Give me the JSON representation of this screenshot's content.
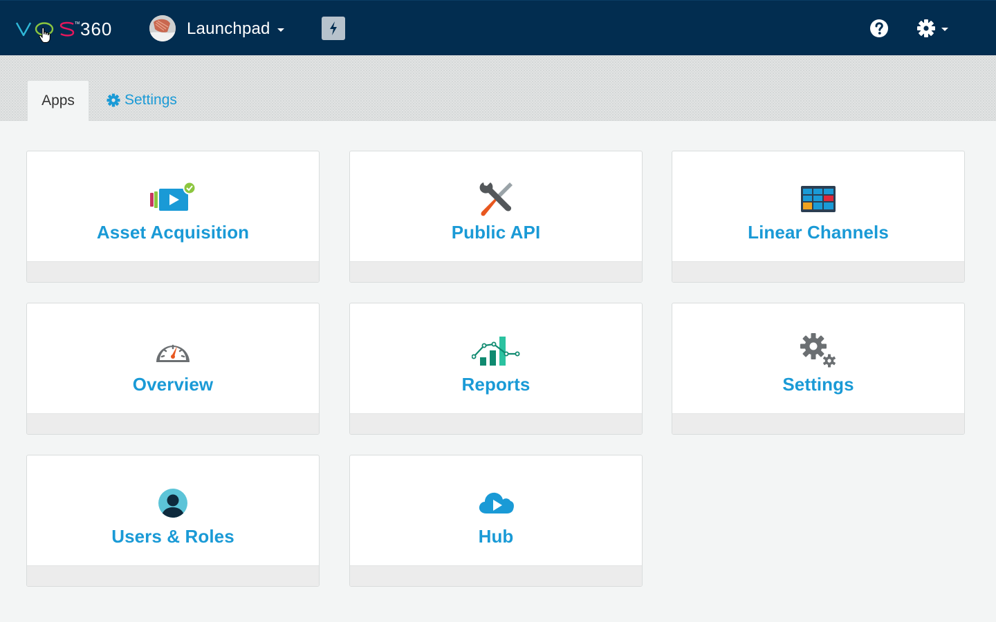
{
  "header": {
    "logo_text": "VOS 360",
    "app_switcher_label": "Launchpad"
  },
  "tabs": [
    {
      "label": "Apps",
      "active": true
    },
    {
      "label": "Settings",
      "icon": "gear-icon",
      "active": false
    }
  ],
  "cards": [
    {
      "label": "Asset Acquisition",
      "icon": "asset-acquisition-icon"
    },
    {
      "label": "Public API",
      "icon": "tools-icon"
    },
    {
      "label": "Linear Channels",
      "icon": "linear-channels-grid-icon"
    },
    {
      "label": "Overview",
      "icon": "speedometer-icon"
    },
    {
      "label": "Reports",
      "icon": "bar-chart-icon"
    },
    {
      "label": "Settings",
      "icon": "gears-icon"
    },
    {
      "label": "Users & Roles",
      "icon": "user-icon"
    },
    {
      "label": "Hub",
      "icon": "cloud-play-icon"
    }
  ],
  "colors": {
    "topbar": "#022d50",
    "accent": "#1a9ad6",
    "card_footer": "#ececec"
  }
}
